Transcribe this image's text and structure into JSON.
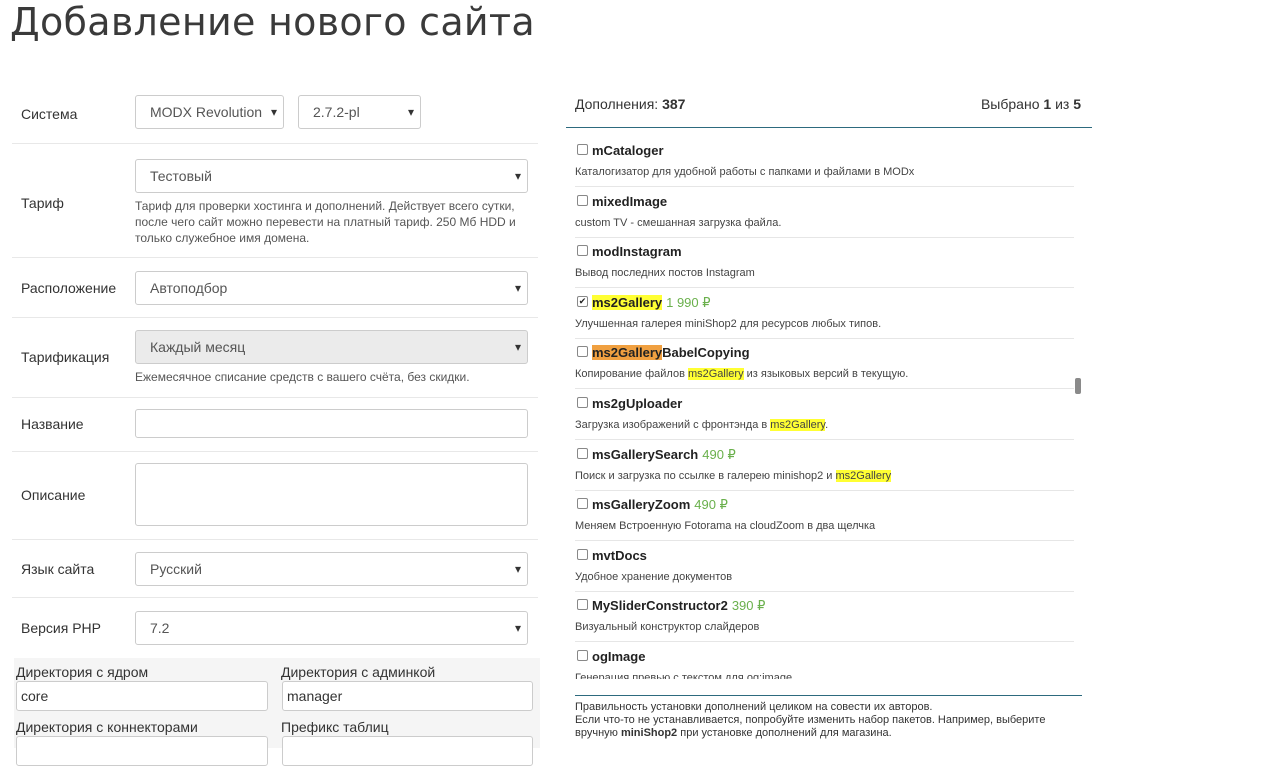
{
  "page_title": "Добавление нового сайта",
  "form": {
    "system": {
      "label": "Система",
      "cms": "MODX Revolution",
      "version": "2.7.2-pl"
    },
    "tariff": {
      "label": "Тариф",
      "value": "Тестовый",
      "hint": "Тариф для проверки хостинга и дополнений. Действует всего сутки, после чего сайт можно перевести на платный тариф. 250 Мб HDD и только служебное имя домена."
    },
    "location": {
      "label": "Расположение",
      "value": "Автоподбор"
    },
    "billing": {
      "label": "Тарификация",
      "value": "Каждый месяц",
      "hint": "Ежемесячное списание средств с вашего счёта, без скидки."
    },
    "name": {
      "label": "Название",
      "value": ""
    },
    "description": {
      "label": "Описание",
      "value": ""
    },
    "language": {
      "label": "Язык сайта",
      "value": "Русский"
    },
    "php": {
      "label": "Версия PHP",
      "value": "7.2"
    },
    "core_dir": {
      "label": "Директория с ядром",
      "value": "core"
    },
    "manager_dir": {
      "label": "Директория с админкой",
      "value": "manager"
    },
    "connectors_dir": {
      "label": "Директория с коннекторами",
      "value": ""
    },
    "table_prefix": {
      "label": "Префикс таблиц",
      "value": ""
    }
  },
  "addons": {
    "count_label": "Дополнения:",
    "count": "387",
    "selected_label": "Выбрано",
    "selected": "1",
    "of": "из",
    "max": "5",
    "items": [
      {
        "name": "mCataloger",
        "price": "",
        "checked": false,
        "desc": "Каталогизатор для удобной работы с папками и файлами в MODx"
      },
      {
        "name": "mixedImage",
        "price": "",
        "checked": false,
        "desc": "custom TV - смешанная загрузка файла."
      },
      {
        "name": "modInstagram",
        "price": "",
        "checked": false,
        "desc": "Вывод последних постов Instagram"
      },
      {
        "name": "ms2Gallery",
        "price": "1 990 ₽",
        "checked": true,
        "desc": "Улучшенная галерея miniShop2 для ресурсов любых типов."
      },
      {
        "name_hl": "ms2Gallery",
        "name_rest": "BabelCopying",
        "price": "",
        "checked": false,
        "desc_pre": "Копирование файлов ",
        "desc_hl": "ms2Gallery",
        "desc_post": " из языковых версий в текущую."
      },
      {
        "name": "ms2gUploader",
        "price": "",
        "checked": false,
        "desc_pre": "Загрузка изображений с фронтэнда в ",
        "desc_hl": "ms2Gallery",
        "desc_post": "."
      },
      {
        "name": "msGallerySearch",
        "price": "490 ₽",
        "checked": false,
        "desc_pre": "Поиск и загрузка по ссылке в галерею minishop2 и ",
        "desc_hl": "ms2Gallery",
        "desc_post": ""
      },
      {
        "name": "msGalleryZoom",
        "price": "490 ₽",
        "checked": false,
        "desc": "Меняем Встроенную Fotorama на cloudZoom в два щелчка"
      },
      {
        "name": "mvtDocs",
        "price": "",
        "checked": false,
        "desc": "Удобное хранение документов"
      },
      {
        "name": "MySliderConstructor2",
        "price": "390 ₽",
        "checked": false,
        "desc": "Визуальный конструктор слайдеров"
      },
      {
        "name": "ogImage",
        "price": "",
        "checked": false,
        "desc": "Генерация превью с текстом для og:image"
      }
    ],
    "footer_line1": "Правильность установки дополнений целиком на совести их авторов.",
    "footer_line2": "Если что-то не устанавливается, попробуйте изменить набор пакетов. Например, выберите",
    "footer_line3_pre": "вручную ",
    "footer_line3_bold": "miniShop2",
    "footer_line3_post": " при установке дополнений для магазина."
  }
}
